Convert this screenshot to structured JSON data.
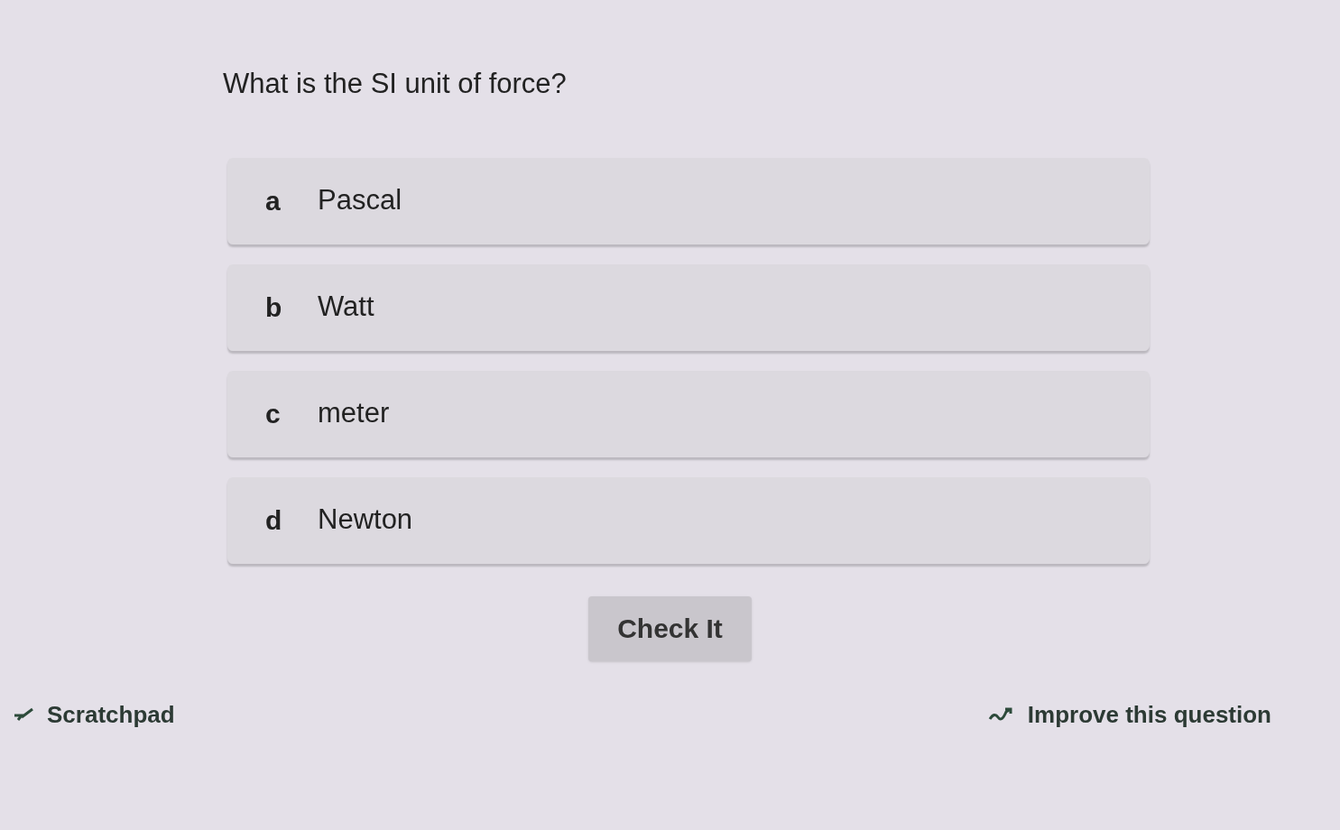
{
  "question": "What is the SI unit of force?",
  "choices": [
    {
      "letter": "a",
      "label": "Pascal",
      "selected": false
    },
    {
      "letter": "b",
      "label": "Watt",
      "selected": false
    },
    {
      "letter": "c",
      "label": "meter",
      "selected": false
    },
    {
      "letter": "d",
      "label": "Newton",
      "selected": false
    }
  ],
  "check_button": "Check It",
  "scratchpad_link": "Scratchpad",
  "improve_link": "Improve this question"
}
